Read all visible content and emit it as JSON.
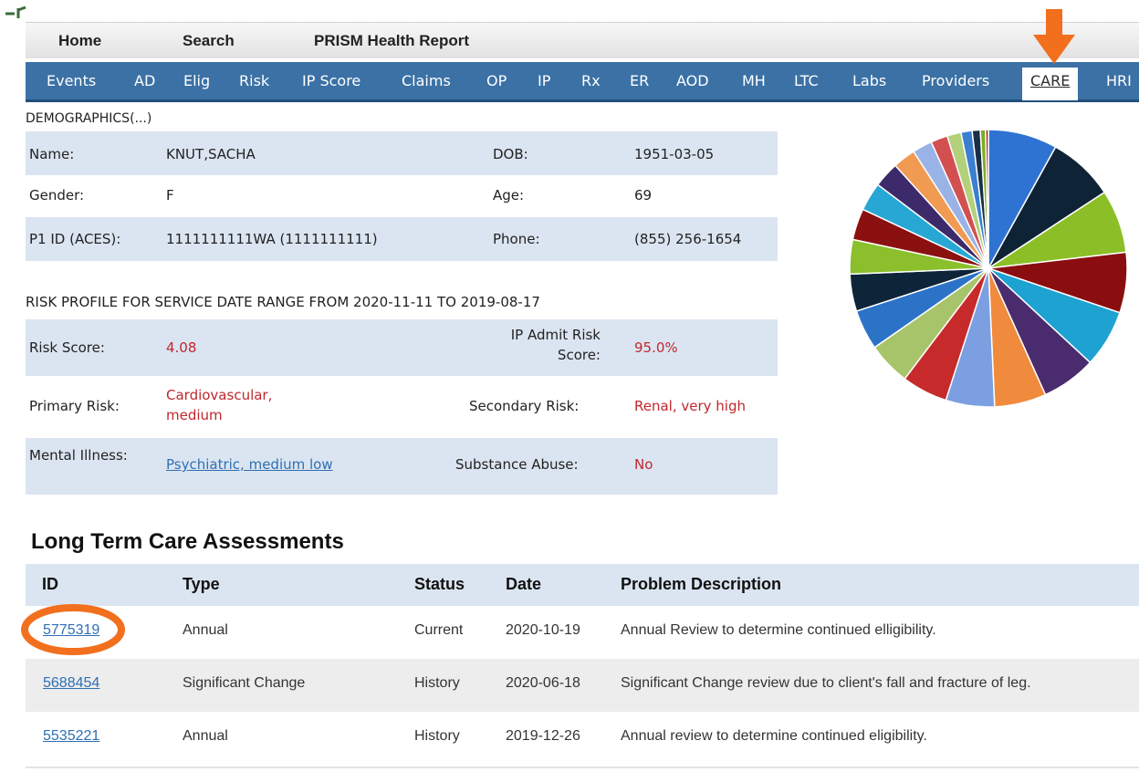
{
  "colors": {
    "tab_bar": "#3b71a5",
    "row_shade": "#dbe5f1",
    "risk_red": "#c0272d",
    "link_blue": "#2f6fb3",
    "annotation_orange": "#f26f1d"
  },
  "top_nav": [
    "Home",
    "Search",
    "PRISM Health Report"
  ],
  "tabs": [
    "Events",
    "AD",
    "Elig",
    "Risk",
    "IP Score",
    "Claims",
    "OP",
    "IP",
    "Rx",
    "ER",
    "AOD",
    "MH",
    "LTC",
    "Labs",
    "Providers",
    "CARE",
    "HRI"
  ],
  "active_tab": "CARE",
  "demographics": {
    "title": "DEMOGRAPHICS(...)",
    "name_label": "Name:",
    "name_value": "KNUT,SACHA",
    "dob_label": "DOB:",
    "dob_value": "1951-03-05",
    "gender_label": "Gender:",
    "gender_value": "F",
    "age_label": "Age:",
    "age_value": "69",
    "p1_label": "P1 ID (ACES):",
    "p1_value": "1111111111WA (1111111111)",
    "phone_label": "Phone:",
    "phone_value": "(855) 256-1654"
  },
  "risk": {
    "title": "RISK PROFILE FOR SERVICE DATE RANGE FROM 2020-11-11 TO 2019-08-17",
    "score_label": "Risk Score:",
    "score_value": "4.08",
    "ip_label": "IP Admit Risk Score:",
    "ip_value": "95.0%",
    "primary_label": "Primary Risk:",
    "primary_value": "Cardiovascular, medium",
    "secondary_label": "Secondary Risk:",
    "secondary_value": "Renal, very high",
    "mental_label": "Mental Illness:",
    "mental_value": "Psychiatric, medium low",
    "substance_label": "Substance Abuse:",
    "substance_value": "No"
  },
  "pie_colors": [
    "#2f73d2",
    "#0f2336",
    "#8cbf27",
    "#8a0e10",
    "#1da2d1",
    "#4a2c6e",
    "#f08a3c",
    "#7b9fe0",
    "#c62a2a",
    "#a7c46a",
    "#2c73c8",
    "#0e2438",
    "#8bbf2c",
    "#8b1111",
    "#27a7d4",
    "#3d2a6a",
    "#f09a52",
    "#9ab3e6",
    "#d25050",
    "#b3d07a",
    "#3a7fd0",
    "#1a2e44",
    "#7aae22",
    "#a02020"
  ],
  "ltc": {
    "title": "Long Term Care Assessments",
    "columns": [
      "ID",
      "Type",
      "Status",
      "Date",
      "Problem Description"
    ],
    "rows": [
      [
        "5775319",
        "Annual",
        "Current",
        "2020-10-19",
        "Annual Review to determine continued elligibility."
      ],
      [
        "5688454",
        "Significant Change",
        "History",
        "2020-06-18",
        "Significant Change review due to client's fall and fracture of leg."
      ],
      [
        "5535221",
        "Annual",
        "History",
        "2019-12-26",
        "Annual review to determine continued eligibility."
      ]
    ]
  }
}
